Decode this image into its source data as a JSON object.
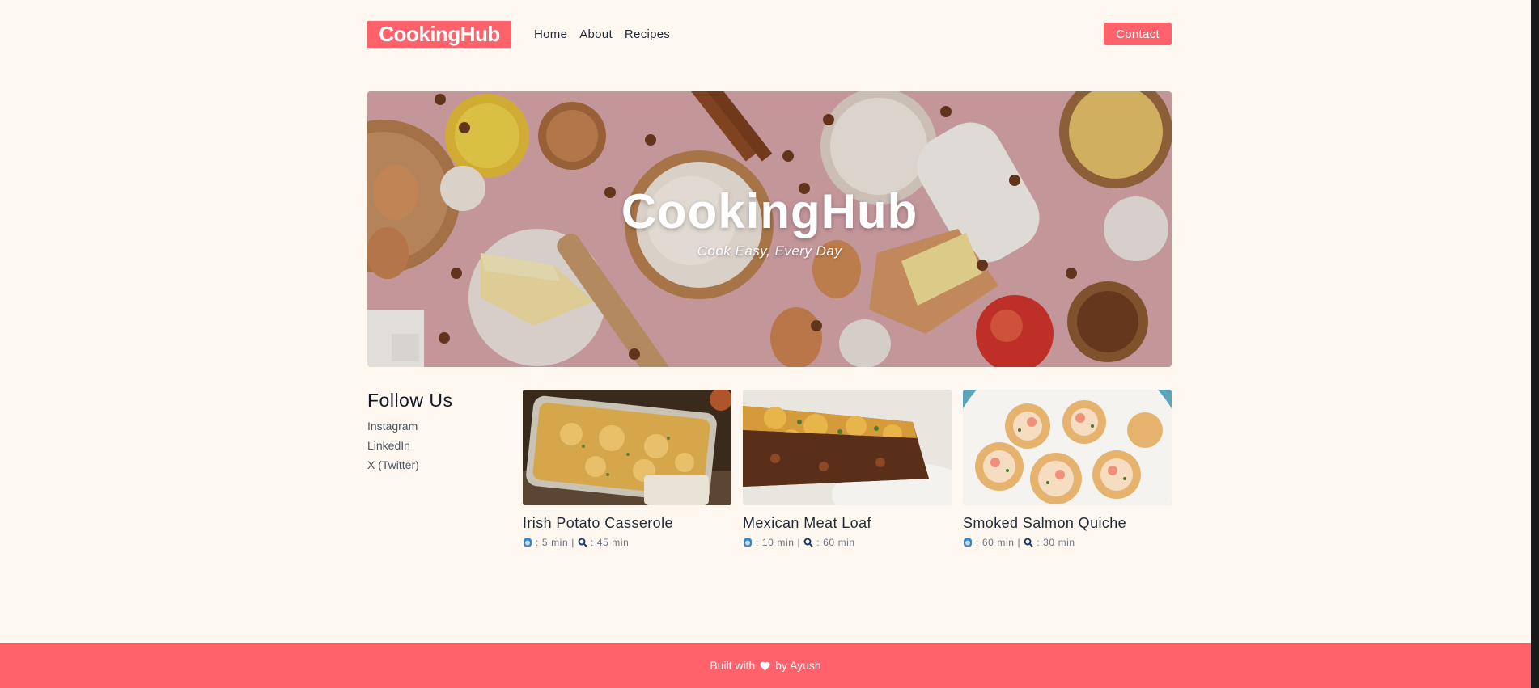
{
  "brand": {
    "logo_text": "CookingHub",
    "accent": "#ff626b",
    "background": "#fff8f0"
  },
  "nav": {
    "items": [
      "Home",
      "About",
      "Recipes"
    ],
    "contact_label": "Contact"
  },
  "hero": {
    "title": "CookingHub",
    "subtitle": "Cook Easy, Every Day"
  },
  "follow": {
    "heading": "Follow Us",
    "links": [
      "Instagram",
      "LinkedIn",
      "X (Twitter)"
    ]
  },
  "recipes": [
    {
      "title": "Irish Potato Casserole",
      "prep": ": 5 min",
      "sep": "|",
      "cook": ": 45 min"
    },
    {
      "title": "Mexican Meat Loaf",
      "prep": ": 10 min",
      "sep": "|",
      "cook": ": 60 min"
    },
    {
      "title": "Smoked Salmon Quiche",
      "prep": ": 60 min",
      "sep": "|",
      "cook": ": 30 min"
    }
  ],
  "footer": {
    "prefix": "Built with",
    "suffix": "by Ayush",
    "icon": "heart-icon"
  }
}
